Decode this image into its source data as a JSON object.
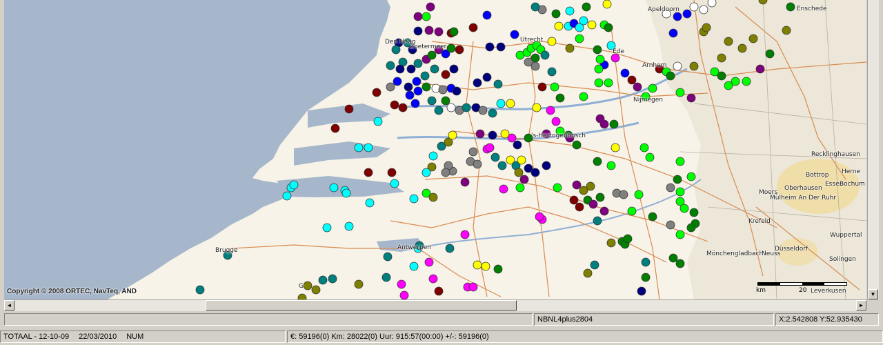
{
  "map": {
    "copyright": "Copyright © 2008 ORTEC, NavTeq, AND",
    "scale_unit": "km",
    "scale_value": "20",
    "labels": [
      {
        "name": "apeldoorn",
        "text": "Apeldoorn"
      },
      {
        "name": "enschede",
        "text": "Enschede"
      },
      {
        "name": "den-haag",
        "text": "Den Haag"
      },
      {
        "name": "zoetermeer",
        "text": "Zoetermeer"
      },
      {
        "name": "utrecht",
        "text": "Utrecht"
      },
      {
        "name": "ede",
        "text": "Ede"
      },
      {
        "name": "arnhem",
        "text": "Arnhem"
      },
      {
        "name": "nijmegen",
        "text": "Nijmegen"
      },
      {
        "name": "den-bosch",
        "text": "'s-Hertogenbosch"
      },
      {
        "name": "recklinghausen",
        "text": "Recklinghausen"
      },
      {
        "name": "bottrop",
        "text": "Bottrop"
      },
      {
        "name": "herne",
        "text": "Herne"
      },
      {
        "name": "essen",
        "text": "Essen"
      },
      {
        "name": "bochum",
        "text": "Bochum"
      },
      {
        "name": "moers",
        "text": "Moers"
      },
      {
        "name": "oberhausen",
        "text": "Oberhausen"
      },
      {
        "name": "mulheim",
        "text": "Mülheim An Der Ruhr"
      },
      {
        "name": "krefeld",
        "text": "Krefeld"
      },
      {
        "name": "wuppertal",
        "text": "Wuppertal"
      },
      {
        "name": "brugge",
        "text": "Brugge"
      },
      {
        "name": "antwerpen",
        "text": "Antwerpen"
      },
      {
        "name": "dusseldorf",
        "text": "Düsseldorf"
      },
      {
        "name": "monchengladbach",
        "text": "Mönchengladbach"
      },
      {
        "name": "neuss",
        "text": "Neuss"
      },
      {
        "name": "solingen",
        "text": "Solingen"
      },
      {
        "name": "leverkusen",
        "text": "Leverkusen"
      },
      {
        "name": "gent",
        "text": "G"
      }
    ],
    "marker_colors": {
      "darkblue": "#00007f",
      "blue": "#0000ff",
      "cyan": "#00ffff",
      "teal": "#007f7f",
      "green": "#00ff00",
      "darkgreen": "#007f00",
      "olive": "#7f7f00",
      "yellow": "#ffff00",
      "magenta": "#ff00ff",
      "purple": "#7f007f",
      "maroon": "#7f0000",
      "gray": "#808080",
      "white": "#ffffff"
    }
  },
  "statusbar_top": {
    "map_name": "NBNL4plus2804",
    "coordinates": "X:2.542808 Y:52.935430"
  },
  "statusbar_bottom": {
    "totaal": "TOTAAL - 12-10-09",
    "date": "22/03/2010",
    "num": "NUM",
    "summary": "€: 59196(0) Km: 28022(0) Uur: 915:57(00:00) +/-: 59196(0)"
  }
}
